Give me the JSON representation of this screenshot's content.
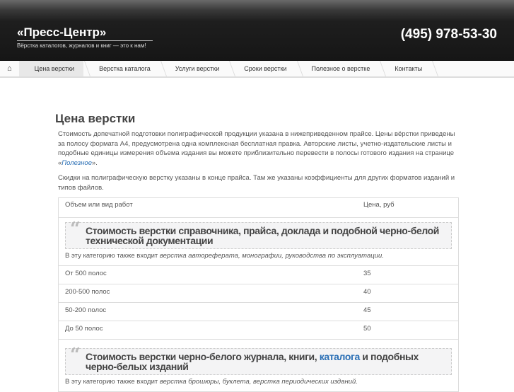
{
  "header": {
    "logo": "«Пресс-Центр»",
    "tagline": "Вёрстка каталогов, журналов и книг — это к нам!",
    "phone": "(495) 978-53-30"
  },
  "nav": {
    "items": [
      "Цена верстки",
      "Верстка каталога",
      "Услуги верстки",
      "Сроки верстки",
      "Полезное о верстке",
      "Контакты"
    ]
  },
  "page": {
    "title": "Цена верстки",
    "p1": "Стоимость допечатной подготовки полиграфической продукции указана в нижеприведенном прайсе. Цены вёрстки приведены за полосу формата А4, предусмотрена одна комплексная бесплатная правка. Авторские листы, учетно-издательские листы и подобные единицы измерения объема издания вы можете приблизительно перевести в полосы готового издания на странице «",
    "p1_link": "Полезное",
    "p1_end": "».",
    "p2": "Скидки на полиграфическую верстку указаны в конце прайса. Там же указаны коэффициенты для других форматов изданий и типов файлов."
  },
  "table": {
    "headers": [
      "Объем или вид работ",
      "Цена, руб"
    ],
    "section1": {
      "title": "Стоимость верстки справочника, прайса, доклада и подобной черно-белой технической документации",
      "note": "В эту категорию также входит ",
      "note_em": "верстка автореферата, монографии, руководства по эксплуатации."
    },
    "rows": [
      [
        "От 500 полос",
        "35"
      ],
      [
        "200-500 полос",
        "40"
      ],
      [
        "50-200 полос",
        "45"
      ],
      [
        "До 50 полос",
        "50"
      ]
    ],
    "section2": {
      "title_a": "Стоимость верстки черно-белого журнала, книги, ",
      "title_link": "каталога",
      "title_b": " и подобных черно-белых изданий",
      "note": "В эту категорию также входит ",
      "note_em": "верстка брошюры, буклета, верстка периодических изданий."
    }
  }
}
